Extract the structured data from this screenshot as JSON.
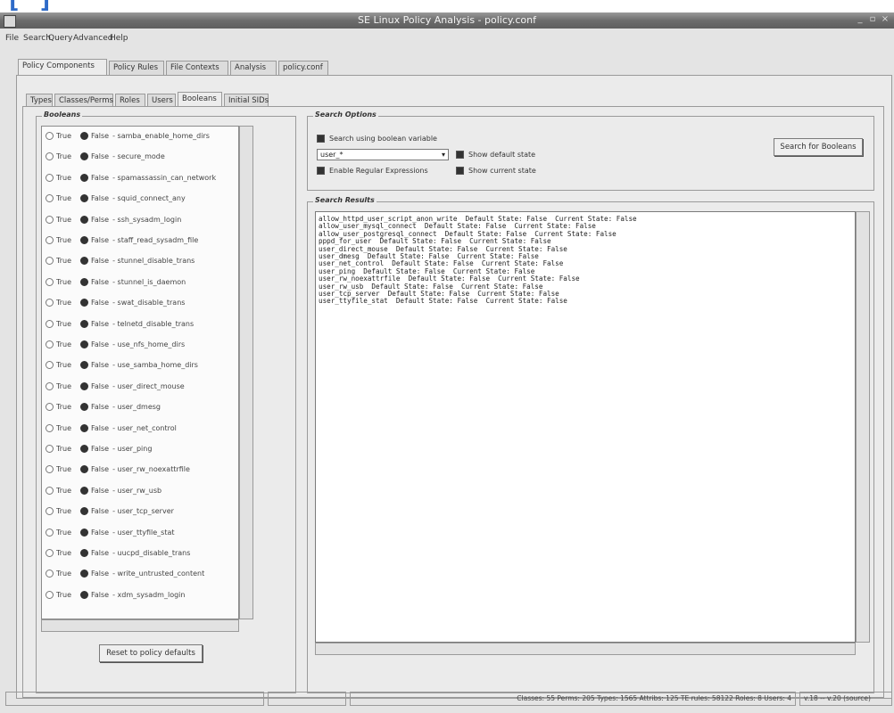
{
  "window": {
    "title": "SE Linux Policy Analysis - policy.conf"
  },
  "menu": [
    "File",
    "Search",
    "Query",
    "Advanced",
    "Help"
  ],
  "main_tabs": [
    "Policy Components",
    "Policy Rules",
    "File Contexts",
    "Analysis",
    "policy.conf"
  ],
  "sub_tabs": [
    "Types",
    "Classes/Perms",
    "Roles",
    "Users",
    "Booleans",
    "Initial SIDs"
  ],
  "booleans_frame": {
    "label": "Booleans",
    "true_label": "True",
    "false_label": "False",
    "items": [
      "- samba_enable_home_dirs",
      "- secure_mode",
      "- spamassassin_can_network",
      "- squid_connect_any",
      "- ssh_sysadm_login",
      "- staff_read_sysadm_file",
      "- stunnel_disable_trans",
      "- stunnel_is_daemon",
      "- swat_disable_trans",
      "- telnetd_disable_trans",
      "- use_nfs_home_dirs",
      "- use_samba_home_dirs",
      "- user_direct_mouse",
      "- user_dmesg",
      "- user_net_control",
      "- user_ping",
      "- user_rw_noexattrfile",
      "- user_rw_usb",
      "- user_tcp_server",
      "- user_ttyfile_stat",
      "- uucpd_disable_trans",
      "- write_untrusted_content",
      "- xdm_sysadm_login"
    ],
    "reset_button": "Reset to policy defaults"
  },
  "search_options": {
    "label": "Search Options",
    "use_variable": "Search using boolean variable",
    "combo_value": "user_*",
    "enable_regex": "Enable Regular Expressions",
    "show_default": "Show default state",
    "show_current": "Show current state",
    "search_button": "Search for Booleans"
  },
  "search_results": {
    "label": "Search Results",
    "text": "allow_httpd_user_script_anon_write  Default State: False  Current State: False\nallow_user_mysql_connect  Default State: False  Current State: False\nallow_user_postgresql_connect  Default State: False  Current State: False\npppd_for_user  Default State: False  Current State: False\nuser_direct_mouse  Default State: False  Current State: False\nuser_dmesg  Default State: False  Current State: False\nuser_net_control  Default State: False  Current State: False\nuser_ping  Default State: False  Current State: False\nuser_rw_noexattrfile  Default State: False  Current State: False\nuser_rw_usb  Default State: False  Current State: False\nuser_tcp_server  Default State: False  Current State: False\nuser_ttyfile_stat  Default State: False  Current State: False"
  },
  "statusbar": {
    "stats": "Classes: 55   Perms: 205   Types: 1565   Attribs: 125   TE rules: 58122   Roles: 8   Users: 4",
    "version": "v.18 -- v.20 (source)"
  }
}
